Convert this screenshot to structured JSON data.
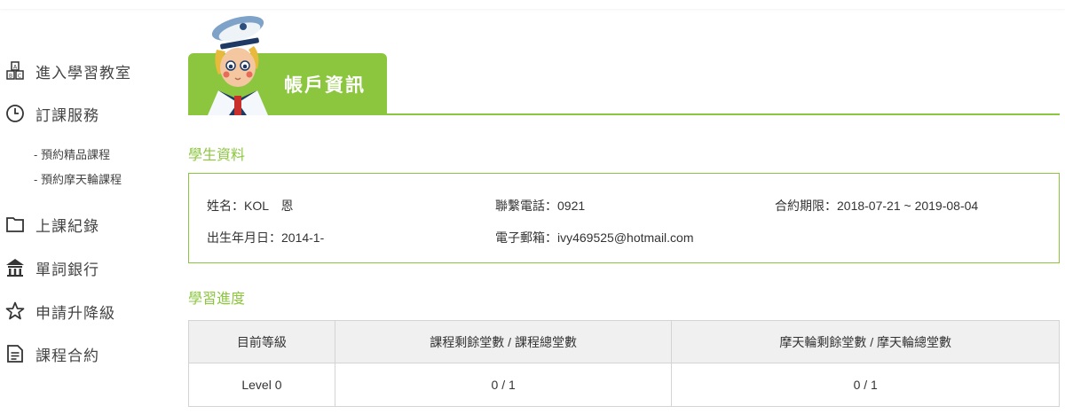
{
  "sidebar": {
    "items": [
      {
        "label": "進入學習教室",
        "icon": "classroom-abc-icon"
      },
      {
        "label": "訂課服務",
        "icon": "clock-icon"
      },
      {
        "label": "上課紀錄",
        "icon": "folder-icon"
      },
      {
        "label": "單詞銀行",
        "icon": "bank-icon"
      },
      {
        "label": "申請升降級",
        "icon": "star-icon"
      },
      {
        "label": "課程合約",
        "icon": "document-icon"
      }
    ],
    "sub_items": [
      "- 預約精品課程",
      "- 預約摩天輪課程"
    ]
  },
  "header": {
    "title": "帳戶資訊"
  },
  "student_info": {
    "section_title": "學生資料",
    "name": "姓名：KOL　恩",
    "phone": "聯繫電話：0921",
    "contract_period": "合約期限：2018-07-21 ~ 2019-08-04",
    "birthday": "出生年月日：2014-1-",
    "email": "電子郵箱：ivy469525@hotmail.com"
  },
  "progress": {
    "section_title": "學習進度",
    "columns": [
      "目前等級",
      "課程剩餘堂數 / 課程總堂數",
      "摩天輪剩餘堂數 / 摩天輪總堂數"
    ],
    "rows": [
      [
        "Level 0",
        "0 / 1",
        "0 / 1"
      ]
    ]
  },
  "colors": {
    "accent": "#8cc63f",
    "table_header_bg": "#f0f0f0"
  }
}
